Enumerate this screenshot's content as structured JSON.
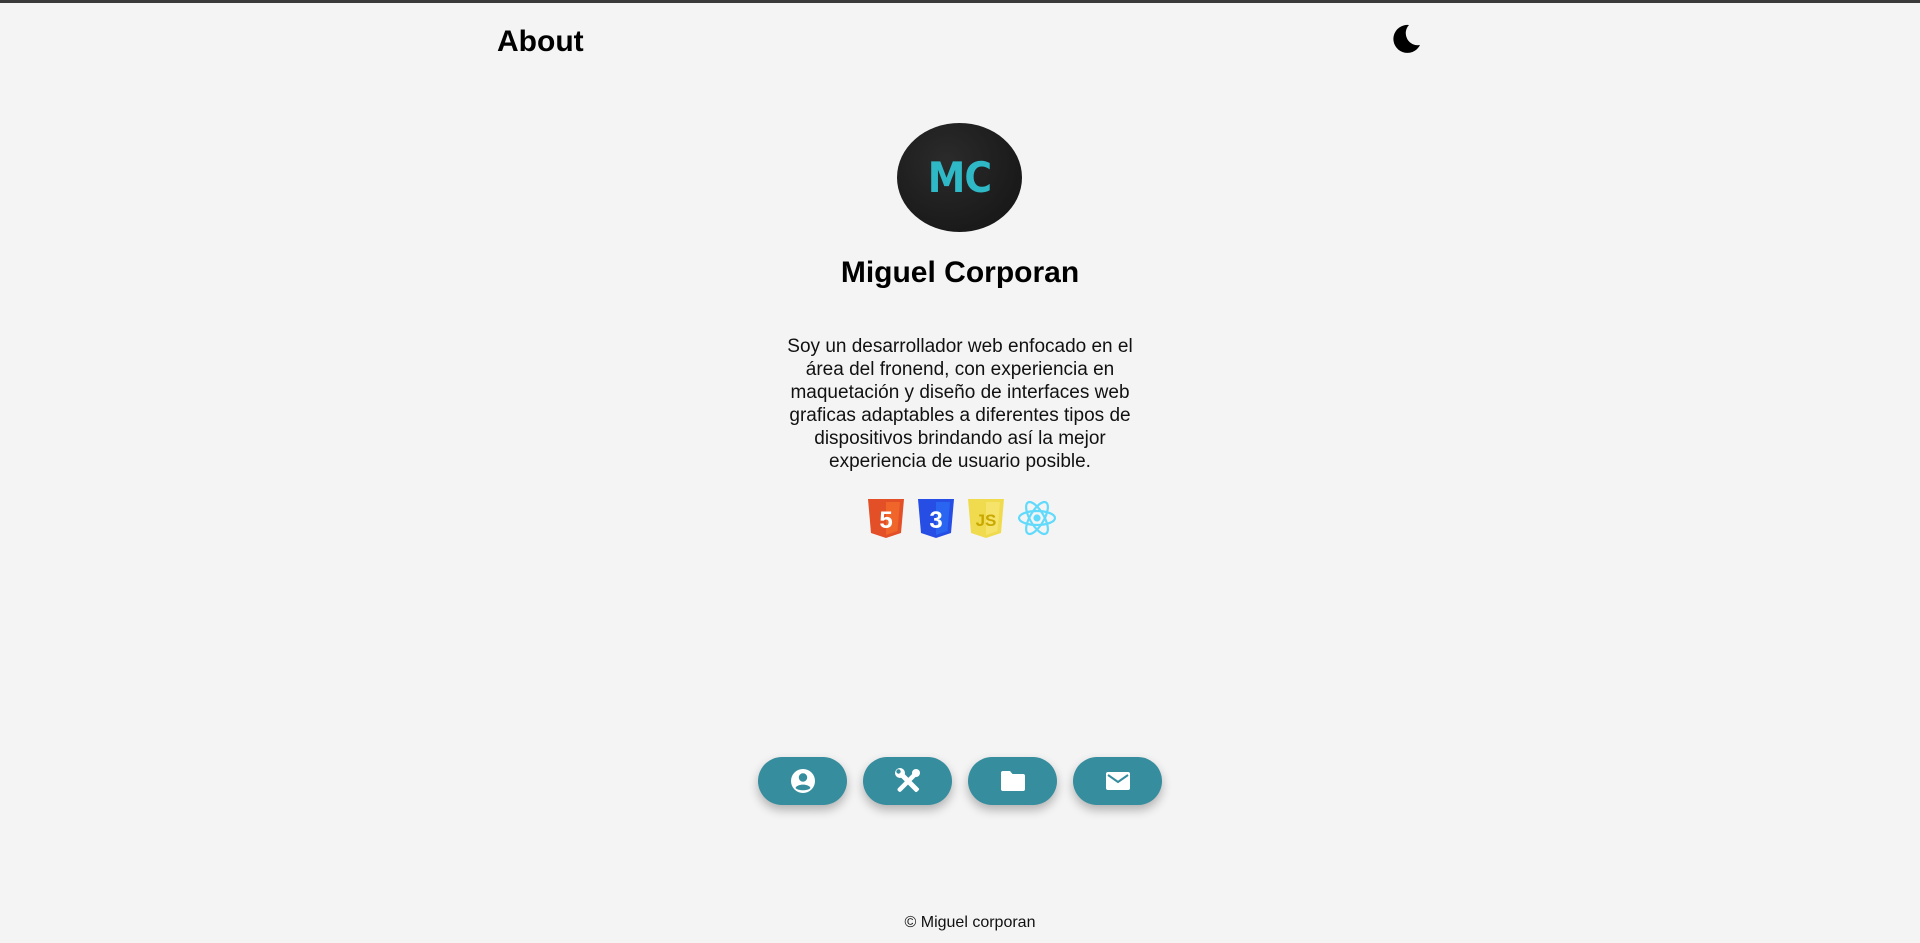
{
  "header": {
    "title": "About",
    "theme_toggle_icon": "moon-icon"
  },
  "profile": {
    "avatar_initials": "MC",
    "avatar_colors": {
      "background": "#1a1a1a",
      "text": "#2fb8c6"
    },
    "name": "Miguel Corporan",
    "bio": "Soy un desarrollador web enfocado en el área del fronend, con experiencia en maquetación y diseño de interfaces web graficas adaptables a diferentes tipos de dispositivos brindando así la mejor experiencia de usuario posible."
  },
  "technologies": [
    {
      "icon": "html5-icon",
      "label": "5",
      "color": "#e34f26"
    },
    {
      "icon": "css3-icon",
      "label": "3",
      "color": "#264de4"
    },
    {
      "icon": "javascript-icon",
      "label": "JS",
      "color": "#f0db4f"
    },
    {
      "icon": "react-icon",
      "color": "#61dafb"
    }
  ],
  "nav": {
    "button_color": "#358d9e",
    "items": [
      {
        "icon": "user-circle-icon"
      },
      {
        "icon": "tools-icon"
      },
      {
        "icon": "folder-icon"
      },
      {
        "icon": "mail-icon"
      }
    ]
  },
  "footer": {
    "text": "© Miguel corporan"
  }
}
